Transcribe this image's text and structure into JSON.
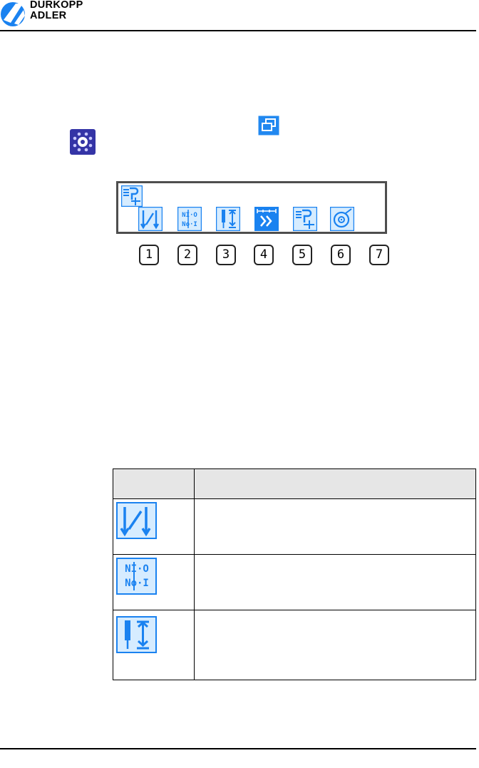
{
  "header": {
    "brand_line1": "DÜRKOPP",
    "brand_line2": "ADLER"
  },
  "icons": {
    "inline_icon_1": "windows-icon",
    "inline_icon_2": "settings-icon"
  },
  "screen": {
    "title_icon": "program-edit-icon",
    "buttons": [
      {
        "icon": "stitch-length-icon"
      },
      {
        "icon": "toggle-io-icon"
      },
      {
        "icon": "needle-position-icon"
      },
      {
        "icon": "fast-forward-icon",
        "selected": true
      },
      {
        "icon": "program-add-icon"
      },
      {
        "icon": "bobbin-icon"
      }
    ]
  },
  "keys": [
    "1",
    "2",
    "3",
    "4",
    "5",
    "6",
    "7"
  ],
  "table": {
    "header": [
      "",
      ""
    ],
    "rows": [
      {
        "icon": "stitch-length-icon",
        "text": ""
      },
      {
        "icon": "toggle-io-icon",
        "text": ""
      },
      {
        "icon": "needle-position-icon",
        "text": ""
      }
    ]
  },
  "colors": {
    "accent_blue": "#1a82f0",
    "icon_fill": "#d6ecff",
    "settings_blue": "#3434a6"
  }
}
